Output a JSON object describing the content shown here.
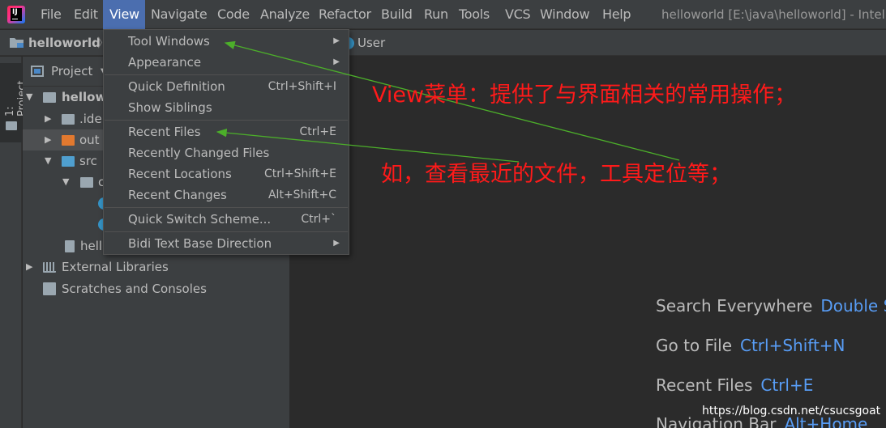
{
  "menubar": {
    "items": [
      "File",
      "Edit",
      "View",
      "Navigate",
      "Code",
      "Analyze",
      "Refactor",
      "Build",
      "Run",
      "Tools",
      "VCS",
      "Window",
      "Help"
    ],
    "active": "View",
    "window_title": "helloworld [E:\\java\\helloworld] - Intelli"
  },
  "navbar": {
    "project": "helloworld",
    "separator": "〉",
    "file": "User"
  },
  "tool_stripe": {
    "project_tab": "1: Project"
  },
  "project_panel": {
    "title": "Project",
    "dropdown": "▼",
    "tree": [
      {
        "label": "hellow",
        "arrow": "▼",
        "icon": "folder-gray",
        "bold": true
      },
      {
        "label": ".ide",
        "arrow": "▶",
        "icon": "folder-gray"
      },
      {
        "label": "out",
        "arrow": "▶",
        "icon": "folder-orange",
        "selected": true
      },
      {
        "label": "src",
        "arrow": "▼",
        "icon": "folder-blue"
      },
      {
        "label": "c",
        "arrow": "▼",
        "icon": "package"
      },
      {
        "label": "",
        "arrow": "",
        "icon": "class-circle"
      },
      {
        "label": "",
        "arrow": "",
        "icon": "class-circle"
      },
      {
        "label": "hell",
        "arrow": "",
        "icon": "file"
      },
      {
        "label": "External Libraries",
        "arrow": "▶",
        "icon": "library"
      },
      {
        "label": "Scratches and Consoles",
        "arrow": "",
        "icon": "scratch"
      }
    ]
  },
  "view_menu": {
    "items": [
      {
        "label": "Tool Windows",
        "shortcut": "",
        "submenu": true
      },
      {
        "label": "Appearance",
        "shortcut": "",
        "submenu": true
      },
      {
        "label": "Quick Definition",
        "shortcut": "Ctrl+Shift+I",
        "submenu": false
      },
      {
        "label": "Show Siblings",
        "shortcut": "",
        "submenu": false
      },
      {
        "label": "Recent Files",
        "shortcut": "Ctrl+E",
        "submenu": false
      },
      {
        "label": "Recently Changed Files",
        "shortcut": "",
        "submenu": false
      },
      {
        "label": "Recent Locations",
        "shortcut": "Ctrl+Shift+E",
        "submenu": false
      },
      {
        "label": "Recent Changes",
        "shortcut": "Alt+Shift+C",
        "submenu": false
      },
      {
        "label": "Quick Switch Scheme...",
        "shortcut": "Ctrl+`",
        "submenu": false
      },
      {
        "label": "Bidi Text Base Direction",
        "shortcut": "",
        "submenu": true
      }
    ]
  },
  "editor_hints": [
    {
      "label": "Search Everywhere",
      "key": "Double Sh"
    },
    {
      "label": "Go to File",
      "key": "Ctrl+Shift+N"
    },
    {
      "label": "Recent Files",
      "key": "Ctrl+E"
    },
    {
      "label": "Navigation Bar",
      "key": "Alt+Home"
    }
  ],
  "annotations": {
    "line1": "View菜单：提供了与界面相关的常用操作；",
    "line2": "如，查看最近的文件，工具定位等；",
    "arrow_color": "#4caf2a",
    "text_color": "#ff1a1a"
  },
  "watermark": "https://blog.csdn.net/csucsgoat",
  "colors": {
    "menubar_bg": "#3c3f41",
    "active_menu": "#4b6eaf",
    "editor_bg": "#2b2b2b",
    "shortcut_blue": "#589df6"
  }
}
